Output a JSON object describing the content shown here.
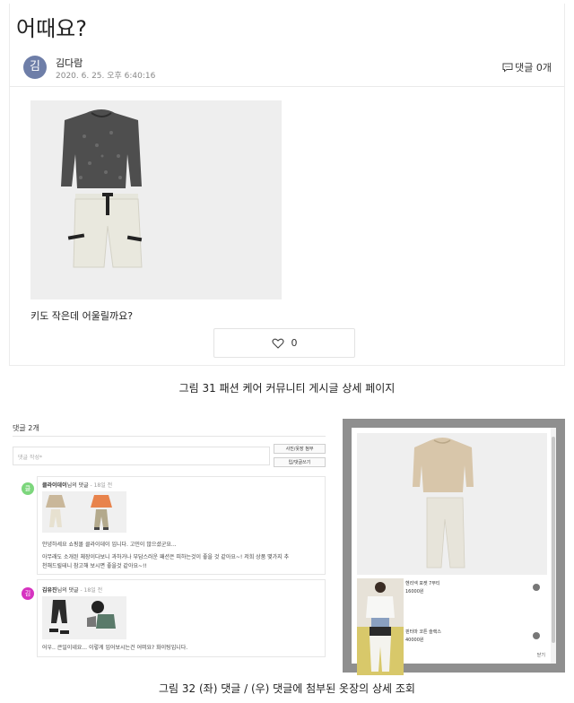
{
  "post": {
    "title": "어때요?",
    "avatar_initial": "김",
    "author": "김다람",
    "date": "2020. 6. 25. 오후 6:40:16",
    "comment_count": "댓글 0개",
    "caption": "키도 작은데 어울릴까요?",
    "like_count": "0"
  },
  "figure_captions": {
    "fig31": "그림 31 패션 케어 커뮤니티 게시글 상세 페이지",
    "fig32": "그림 32 (좌) 댓글 / (우) 댓글에 첨부된 옷장의 상세 조회"
  },
  "comments": {
    "title": "댓글 2개",
    "input_placeholder": "댓글 작성*",
    "attach_button": "사진/옷장 첨부",
    "submit_button": "입/댓글쓰기",
    "items": [
      {
        "avatar_initial": "클",
        "avatar_color": "#7cd67c",
        "name": "클라이데이",
        "name_suffix": "님의 댓글",
        "time": "- 18일 전",
        "lines": [
          "안녕하세요 쇼핑몰 클라이데이 입니다. 고민이 많으셨군요...",
          "아무래도 소개된 체장이다보니 과하거나 부담스러운 패션은 피하는것이 좋을 것 같아요~! 저희 상품 몇가지 추",
          "천해드릴테니 참고해 보시면 좋을것 같아요~!!"
        ]
      },
      {
        "avatar_initial": "김",
        "avatar_color": "#d633c0",
        "name": "김유진",
        "name_suffix": "님의 댓글",
        "time": "- 18일 전",
        "lines": [
          "어우.. 큰일이네요... 이렇게 입어보시는건 어떠요? 화이팅입니다."
        ]
      }
    ]
  },
  "modal": {
    "items": [
      {
        "name": "헨리넥 포켓 7부티",
        "price": "16000원"
      },
      {
        "name": "핀터마 코튼 슬랙스",
        "price": "40000원"
      }
    ],
    "close_label": "닫기"
  }
}
